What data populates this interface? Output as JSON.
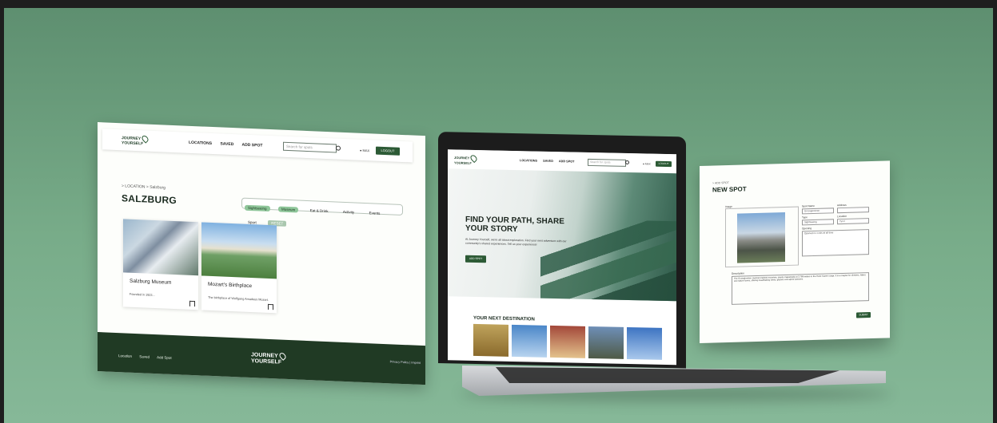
{
  "left_screen": {
    "nav": {
      "logo_line1": "JOURNEY",
      "logo_line2": "YOURSELF",
      "links": [
        "LOCATIONS",
        "SAVED",
        "ADD SPOT"
      ],
      "search_placeholder": "Search for spots",
      "user": "MAX",
      "button": "LOGOUT"
    },
    "breadcrumb": "> LOCATION > Salzburg",
    "city": "SALZBURG",
    "filters": [
      {
        "label": "Sightseeing",
        "active": true
      },
      {
        "label": "Museum",
        "active": true
      },
      {
        "label": "Eat & Drink",
        "active": false
      },
      {
        "label": "Activity",
        "active": false
      },
      {
        "label": "Events",
        "active": false
      },
      {
        "label": "Sport",
        "active": false
      },
      {
        "label": "RESET",
        "active": false
      }
    ],
    "cards": [
      {
        "title": "Salzburg Museum",
        "desc": "Founded in 1923..."
      },
      {
        "title": "Mozart's Birthplace",
        "desc": "The birthplace of Wolfgang Amadeus Mozart."
      }
    ],
    "footer": {
      "links": [
        "Location",
        "Saved",
        "Add Spot"
      ],
      "logo_line1": "JOURNEY",
      "logo_line2": "YOURSELF",
      "legal": "Privacy Policy | Imprint"
    }
  },
  "laptop": {
    "nav": {
      "logo_line1": "JOURNEY",
      "logo_line2": "YOURSELF",
      "links": [
        "LOCATIONS",
        "SAVED",
        "ADD SPOT"
      ],
      "search_placeholder": "Search for spots",
      "user": "MAX",
      "button": "LOGOUT"
    },
    "hero_title": "FIND YOUR PATH, SHARE YOUR STORY",
    "hero_sub": "At Journey Yourself, we're all about exploration. Find your next adventure with our community's shared experiences. Tell us your experience!",
    "hero_button": "ADD SPOT",
    "next_title": "YOUR NEXT DESTINATION"
  },
  "right_screen": {
    "breadcrumb": "> ADD SPOT",
    "title": "NEW SPOT",
    "photo_label": "Image",
    "fields": {
      "spot_name_label": "Spot Name",
      "spot_name_value": "Grossglockner",
      "address_label": "Address",
      "type_label": "Type",
      "type_value": "Sightseeing",
      "location_label": "Location",
      "location_value": "Tyrol",
      "opening_label": "Opening",
      "opening_value": "Opened no costs at all time"
    },
    "description_label": "Description",
    "description_text": "The Grossglockner, Austria's highest mountain, stands majestically at 3,798 meters in the Hohe Tauern range. It is a magnet for climbers, hikers and nature lovers, offering breathtaking views, glaciers and alpine pastures.",
    "submit": "SUBMIT"
  }
}
